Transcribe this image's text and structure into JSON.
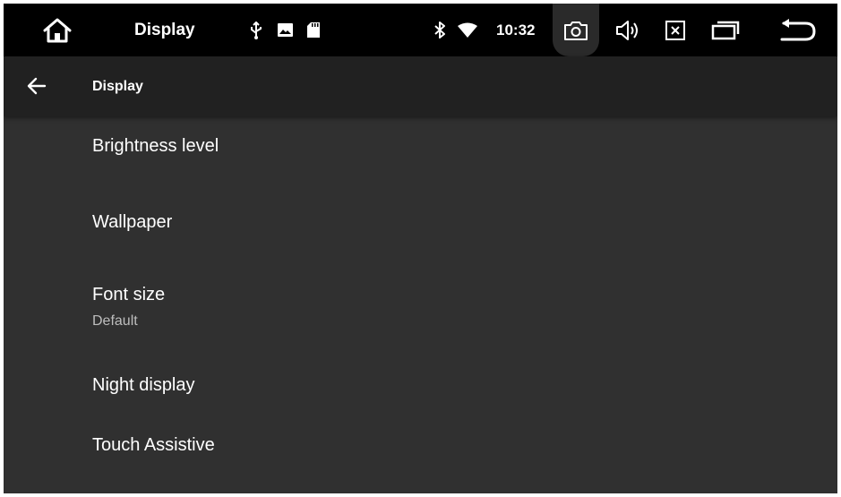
{
  "statusbar": {
    "title": "Display",
    "time": "10:32",
    "icons": [
      "home-icon",
      "usb-icon",
      "image-icon",
      "sd-card-icon",
      "bluetooth-icon",
      "wifi-icon",
      "screenshot-icon",
      "volume-icon",
      "close-app-icon",
      "recent-apps-icon",
      "back-icon"
    ]
  },
  "appbar": {
    "title": "Display",
    "back_icon": "arrow-left-icon"
  },
  "settings": {
    "items": [
      {
        "title": "Brightness level"
      },
      {
        "title": "Wallpaper"
      },
      {
        "title": "Font size",
        "summary": "Default"
      },
      {
        "title": "Night display"
      },
      {
        "title": "Touch Assistive"
      }
    ]
  }
}
